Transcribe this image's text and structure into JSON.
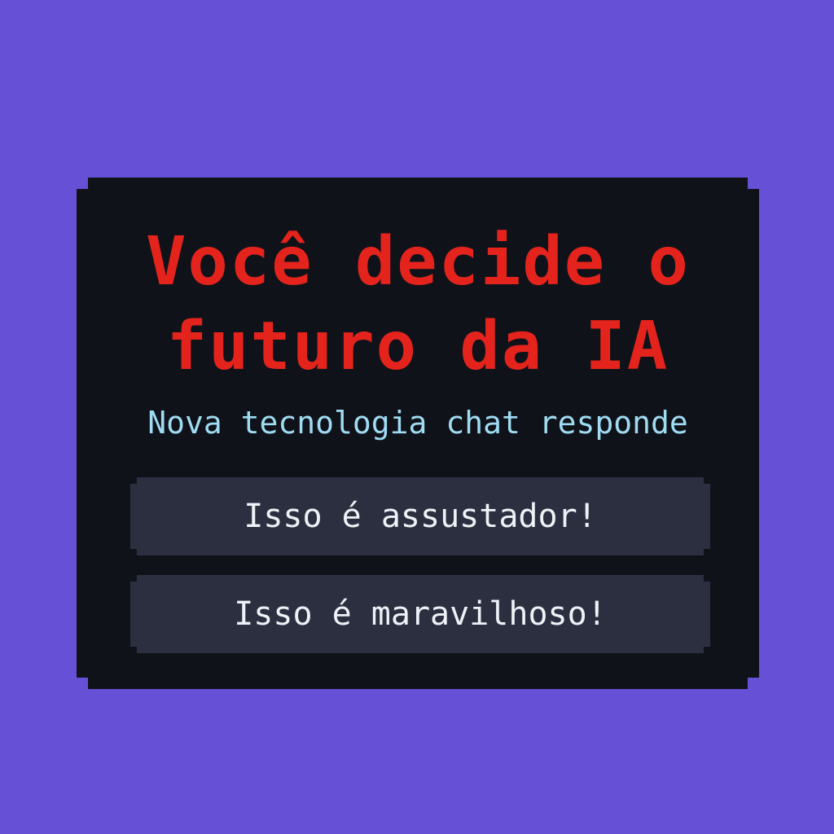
{
  "dialog": {
    "title_line1": "Você decide o",
    "title_line2": "futuro da IA",
    "subtitle": "Nova tecnologia chat responde",
    "choices": [
      {
        "label": "Isso é assustador!"
      },
      {
        "label": "Isso é maravilhoso!"
      }
    ]
  },
  "colors": {
    "background": "#6650d6",
    "panel": "#10121a",
    "title": "#e4241c",
    "subtitle": "#9fdcf2",
    "button": "#2c2f40",
    "button_text": "#eef2f6"
  }
}
